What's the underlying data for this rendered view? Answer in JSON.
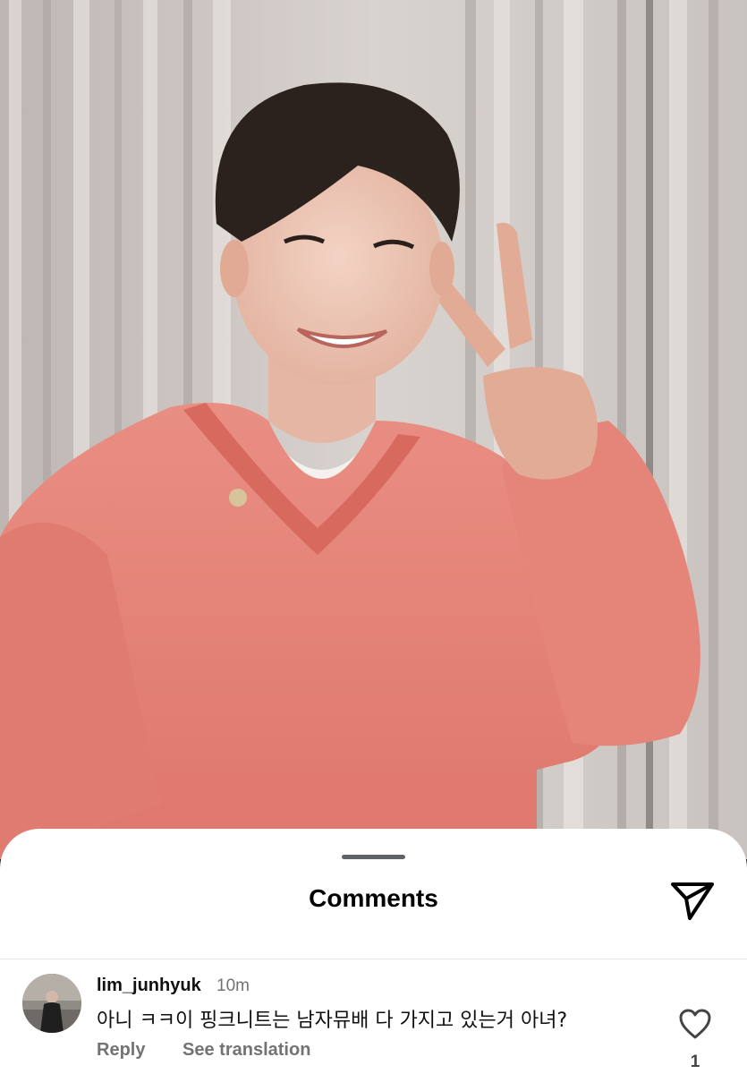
{
  "sheet": {
    "title": "Comments"
  },
  "comment": {
    "username": "lim_junhyuk",
    "time": "10m",
    "text": "아니 ㅋㅋ이 핑크니트는 남자뮤배 다 가지고 있는거 아녀?",
    "reply_label": "Reply",
    "translate_label": "See translation",
    "like_count": "1"
  },
  "icons": {
    "send": "paper-plane-icon",
    "like": "heart-icon"
  },
  "colors": {
    "sheet_background": "#ffffff",
    "secondary_text": "#737373",
    "sweater": "#e8857a"
  }
}
